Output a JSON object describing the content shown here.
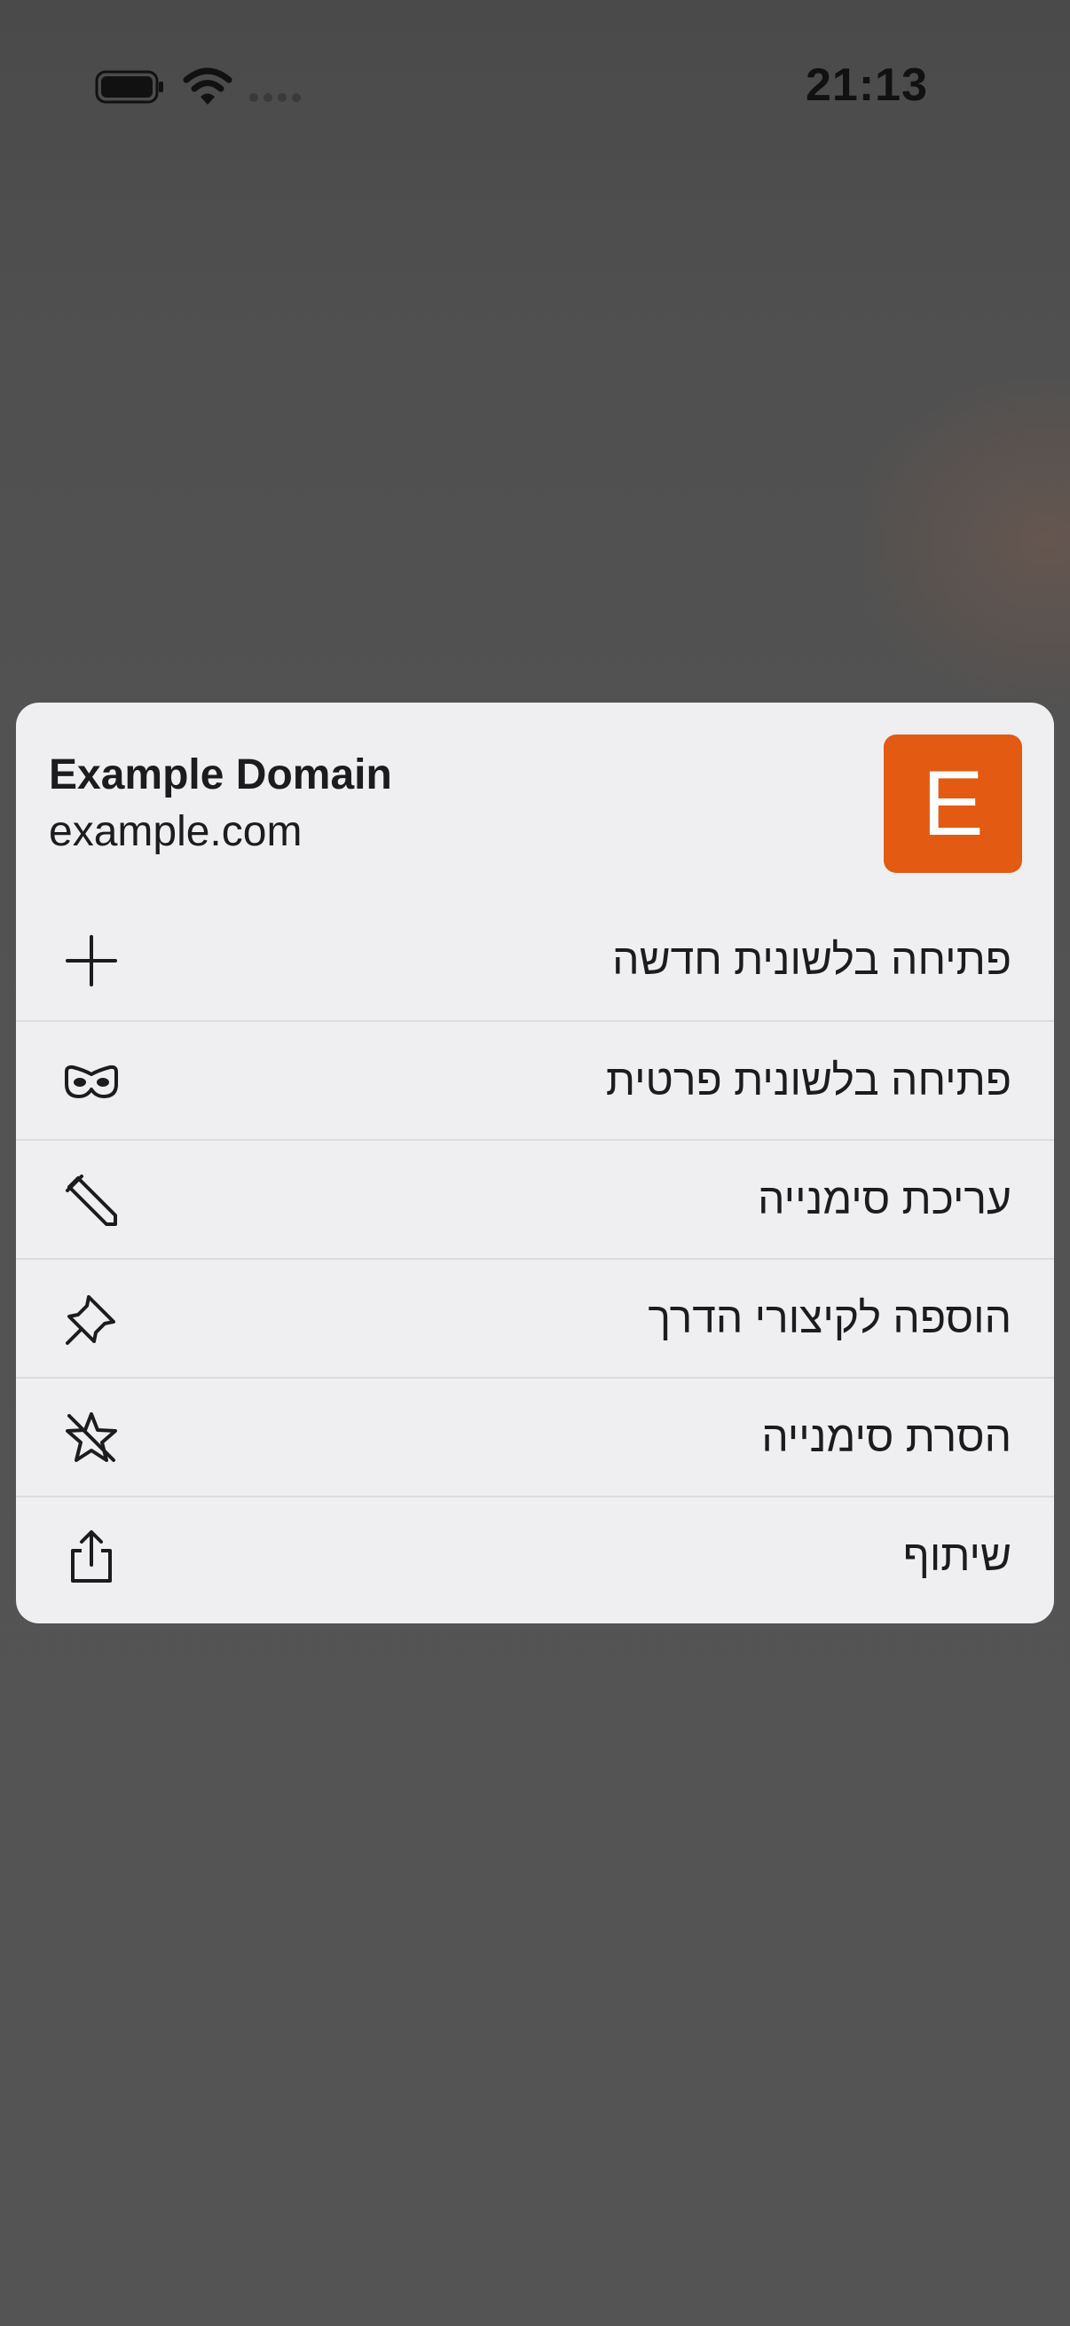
{
  "status_bar": {
    "time": "21:13",
    "icons": [
      "battery-icon",
      "wifi-icon",
      "signal-icon"
    ]
  },
  "menu": {
    "header": {
      "title": "Example Domain",
      "url": "example.com",
      "favicon_letter": "E",
      "favicon_color": "#e35a12"
    },
    "items": [
      {
        "label": "פתיחה בלשונית חדשה",
        "icon": "plus-icon"
      },
      {
        "label": "פתיחה בלשונית פרטית",
        "icon": "private-mask-icon"
      },
      {
        "label": "עריכת סימנייה",
        "icon": "pencil-icon"
      },
      {
        "label": "הוספה לקיצורי הדרך",
        "icon": "pin-icon"
      },
      {
        "label": "הסרת סימנייה",
        "icon": "star-slash-icon"
      },
      {
        "label": "שיתוף",
        "icon": "share-icon"
      }
    ]
  }
}
